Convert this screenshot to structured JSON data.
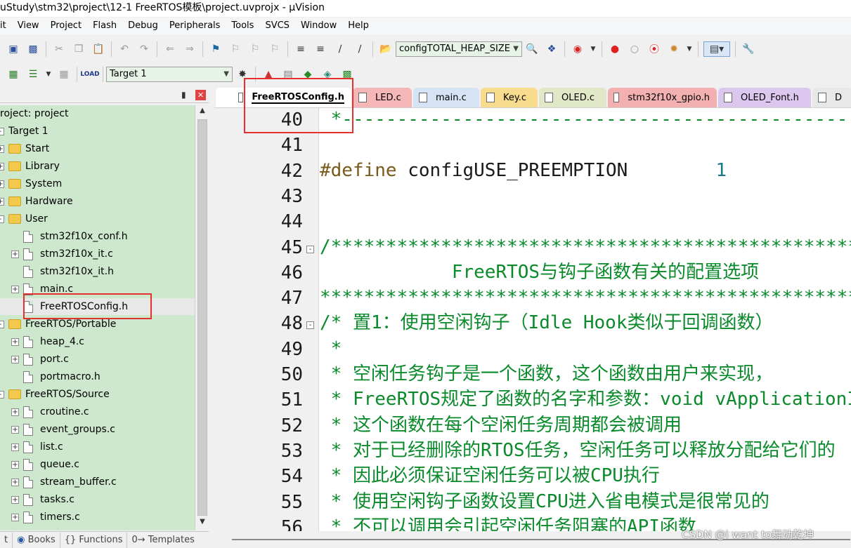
{
  "window": {
    "title": "uStudy\\stm32\\project\\12-1 FreeRTOS模板\\project.uvprojx - µVision"
  },
  "menu": [
    "it",
    "View",
    "Project",
    "Flash",
    "Debug",
    "Peripherals",
    "Tools",
    "SVCS",
    "Window",
    "Help"
  ],
  "toolbar": {
    "find_combo": "configTOTAL_HEAP_SIZE",
    "target_combo": "Target 1"
  },
  "project_panel": {
    "tree": [
      {
        "label": "roject: project",
        "kind": "root",
        "expander": "",
        "level": 0
      },
      {
        "label": "Target 1",
        "kind": "target",
        "expander": "",
        "level": 0
      },
      {
        "label": "Start",
        "kind": "folder",
        "expander": "+",
        "level": 1
      },
      {
        "label": "Library",
        "kind": "folder",
        "expander": "+",
        "level": 1
      },
      {
        "label": "System",
        "kind": "folder",
        "expander": "+",
        "level": 1
      },
      {
        "label": "Hardware",
        "kind": "folder",
        "expander": "+",
        "level": 1
      },
      {
        "label": "User",
        "kind": "folder",
        "expander": "-",
        "level": 1
      },
      {
        "label": "stm32f10x_conf.h",
        "kind": "file",
        "expander": "",
        "level": 2
      },
      {
        "label": "stm32f10x_it.c",
        "kind": "file",
        "expander": "+",
        "level": 2
      },
      {
        "label": "stm32f10x_it.h",
        "kind": "file",
        "expander": "",
        "level": 2
      },
      {
        "label": "main.c",
        "kind": "file",
        "expander": "+",
        "level": 2
      },
      {
        "label": "FreeRTOSConfig.h",
        "kind": "file",
        "expander": "",
        "level": 2,
        "selected": true
      },
      {
        "label": "FreeRTOS/Portable",
        "kind": "folder",
        "expander": "-",
        "level": 1
      },
      {
        "label": "heap_4.c",
        "kind": "file",
        "expander": "+",
        "level": 2
      },
      {
        "label": "port.c",
        "kind": "file",
        "expander": "+",
        "level": 2
      },
      {
        "label": "portmacro.h",
        "kind": "file",
        "expander": "",
        "level": 2
      },
      {
        "label": "FreeRTOS/Source",
        "kind": "folder",
        "expander": "-",
        "level": 1
      },
      {
        "label": "croutine.c",
        "kind": "file",
        "expander": "+",
        "level": 2
      },
      {
        "label": "event_groups.c",
        "kind": "file",
        "expander": "+",
        "level": 2
      },
      {
        "label": "list.c",
        "kind": "file",
        "expander": "+",
        "level": 2
      },
      {
        "label": "queue.c",
        "kind": "file",
        "expander": "+",
        "level": 2
      },
      {
        "label": "stream_buffer.c",
        "kind": "file",
        "expander": "+",
        "level": 2
      },
      {
        "label": "tasks.c",
        "kind": "file",
        "expander": "+",
        "level": 2
      },
      {
        "label": "timers.c",
        "kind": "file",
        "expander": "+",
        "level": 2
      }
    ],
    "bottom_tabs": [
      "t",
      "Books",
      "{} Functions",
      "0→ Templates"
    ]
  },
  "editor_tabs": [
    {
      "label": "FreeRTOSConfig.h",
      "color": "#ffffff",
      "active": true
    },
    {
      "label": "LED.c",
      "color": "#f4b6b6"
    },
    {
      "label": "main.c",
      "color": "#d6e3f4"
    },
    {
      "label": "Key.c",
      "color": "#f6dc8c"
    },
    {
      "label": "OLED.c",
      "color": "#e1e8c8"
    },
    {
      "label": "stm32f10x_gpio.h",
      "color": "#f2b0b0"
    },
    {
      "label": "OLED_Font.h",
      "color": "#dcc8ee"
    },
    {
      "label": "D",
      "color": "#e8e8e8"
    }
  ],
  "code": [
    {
      "n": "40",
      "fold": "",
      "text": " *----------------------------------------------------------",
      "cls": "c-comment"
    },
    {
      "n": "41",
      "fold": "",
      "text": "",
      "cls": "c-ident"
    },
    {
      "n": "42",
      "fold": "",
      "parts": [
        {
          "t": "#define ",
          "cls": "c-define"
        },
        {
          "t": "configUSE_PREEMPTION",
          "cls": "c-ident"
        },
        {
          "t": "        1",
          "cls": "c-num"
        }
      ]
    },
    {
      "n": "43",
      "fold": "",
      "text": "",
      "cls": "c-ident"
    },
    {
      "n": "44",
      "fold": "",
      "text": "",
      "cls": "c-ident"
    },
    {
      "n": "45",
      "fold": "-",
      "text": "/*****************************************************",
      "cls": "c-comment"
    },
    {
      "n": "46",
      "fold": "",
      "text": "            FreeRTOS与钩子函数有关的配置选项",
      "cls": "c-comment"
    },
    {
      "n": "47",
      "fold": "",
      "text": "*****************************************************",
      "cls": "c-comment"
    },
    {
      "n": "48",
      "fold": "-",
      "text": "/* 置1：使用空闲钩子（Idle Hook类似于回调函数）",
      "cls": "c-comment"
    },
    {
      "n": "49",
      "fold": "",
      "text": " *",
      "cls": "c-comment"
    },
    {
      "n": "50",
      "fold": "",
      "text": " * 空闲任务钩子是一个函数，这个函数由用户来实现，",
      "cls": "c-comment"
    },
    {
      "n": "51",
      "fold": "",
      "text": " * FreeRTOS规定了函数的名字和参数：void vApplicationIdleHook",
      "cls": "c-comment"
    },
    {
      "n": "52",
      "fold": "",
      "text": " * 这个函数在每个空闲任务周期都会被调用",
      "cls": "c-comment"
    },
    {
      "n": "53",
      "fold": "",
      "text": " * 对于已经删除的RTOS任务，空闲任务可以释放分配给它们的",
      "cls": "c-comment"
    },
    {
      "n": "54",
      "fold": "",
      "text": " * 因此必须保证空闲任务可以被CPU执行",
      "cls": "c-comment"
    },
    {
      "n": "55",
      "fold": "",
      "text": " * 使用空闲钩子函数设置CPU进入省电模式是很常见的",
      "cls": "c-comment"
    },
    {
      "n": "56",
      "fold": "",
      "text": " * 不可以调用会引起空闲任务阻塞的API函数",
      "cls": "c-comment"
    }
  ],
  "watermark": "CSDN @i want to舞动乾坤"
}
